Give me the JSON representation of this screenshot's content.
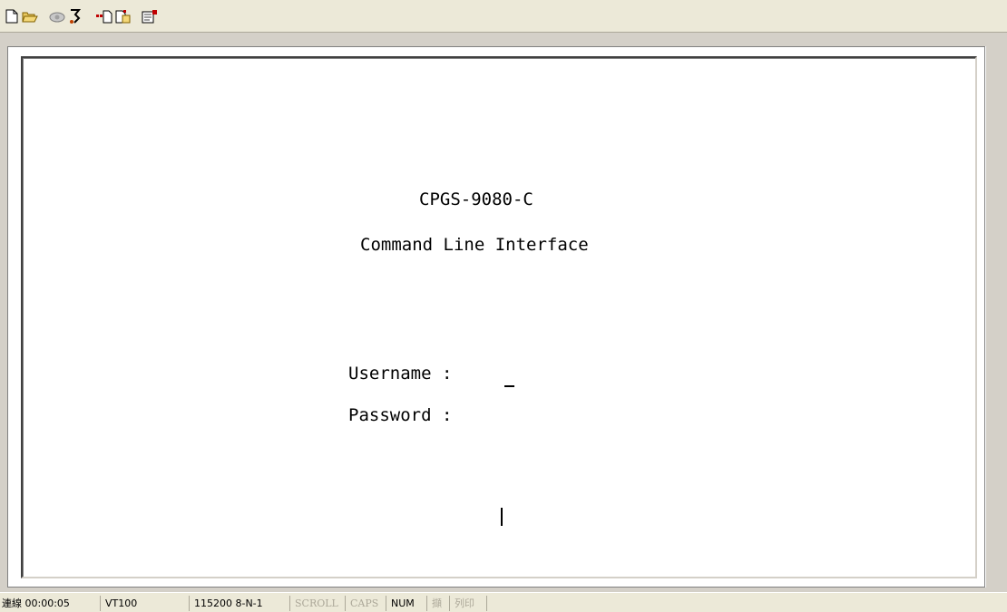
{
  "toolbar": {
    "buttons": [
      {
        "icon": "new-document-icon"
      },
      {
        "icon": "open-folder-icon"
      },
      {
        "icon": "dial-phone-icon"
      },
      {
        "icon": "disconnect-icon"
      },
      {
        "icon": "send-icon"
      },
      {
        "icon": "receive-icon"
      },
      {
        "icon": "properties-icon"
      }
    ]
  },
  "terminal": {
    "title": "CPGS-9080-C",
    "subtitle": "Command Line Interface",
    "username_label": "Username :",
    "password_label": "Password :"
  },
  "statusbar": {
    "connected": "連線 00:00:05",
    "emulation": "VT100",
    "port_settings": "115200 8-N-1",
    "scroll": "SCROLL",
    "caps": "CAPS",
    "num": "NUM",
    "capture": "擷",
    "print": "列印"
  }
}
